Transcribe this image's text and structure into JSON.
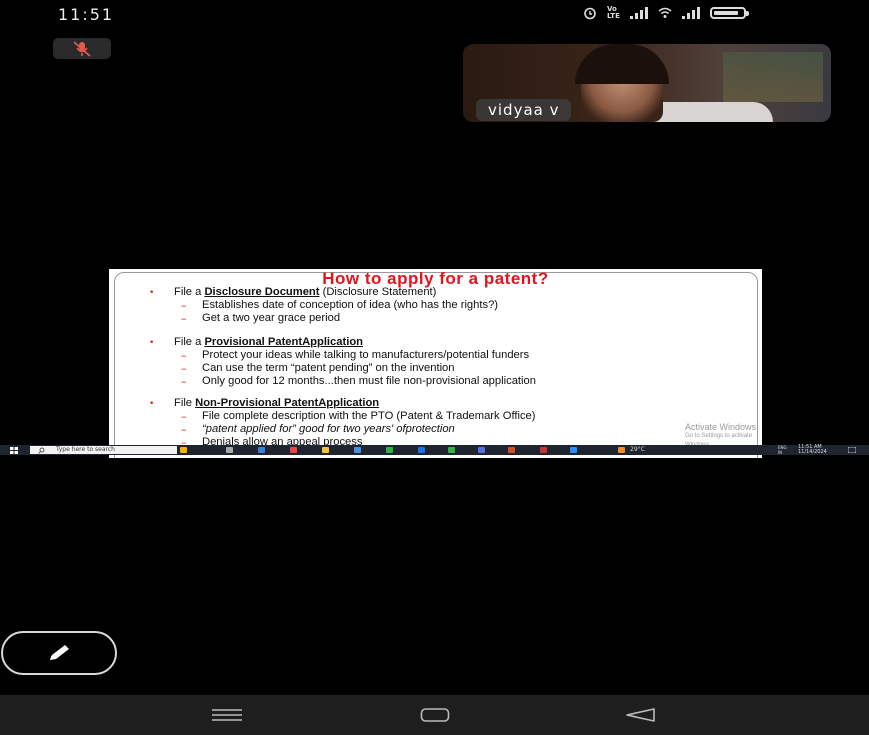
{
  "status_bar": {
    "time": "11:51",
    "volte_label": "Vo\nLTE",
    "icons": [
      "alarm-icon",
      "volte-icon",
      "signal-icon",
      "wifi-icon",
      "signal-icon",
      "battery-icon"
    ]
  },
  "meeting": {
    "mic_state": "muted",
    "participant_name": "vidyaa v"
  },
  "slide": {
    "title": "How to apply for a patent?",
    "items": [
      {
        "prefix": "File a ",
        "link": "Disclosure Document",
        "suffix": " (Disclosure Statement)",
        "subitems": [
          "Establishes date of conception of idea (who has the rights?)",
          "Get a two year grace period"
        ]
      },
      {
        "prefix": "File a ",
        "link": "Provisional PatentApplication",
        "suffix": "",
        "subitems": [
          "Protect your ideas while talking to manufacturers/potential funders",
          "Can use the term “patent pending” on the invention",
          "Only good for 12 months...then must file non-provisional application"
        ]
      },
      {
        "prefix": "File ",
        "link": "Non-Provisional PatentApplication",
        "suffix": "",
        "subitems": [
          "File complete description with the PTO (Patent & Trademark Office)",
          "“patent applied for” good for two years' ofprotection",
          "Denials allow an appeal process"
        ]
      }
    ],
    "watermark_line1": "Activate Windows",
    "watermark_line2": "Go to Settings to activate Windows."
  },
  "taskbar": {
    "search_placeholder": "Type here to search",
    "weather": "29°C",
    "language": "ENG\nIN",
    "clock_time": "11:51 AM",
    "clock_date": "11/14/2024"
  },
  "colors": {
    "slide_title": "#e4141b",
    "bullet": "#dd2222",
    "taskbar": "#1e2530",
    "navbar": "#1e1e1e"
  }
}
